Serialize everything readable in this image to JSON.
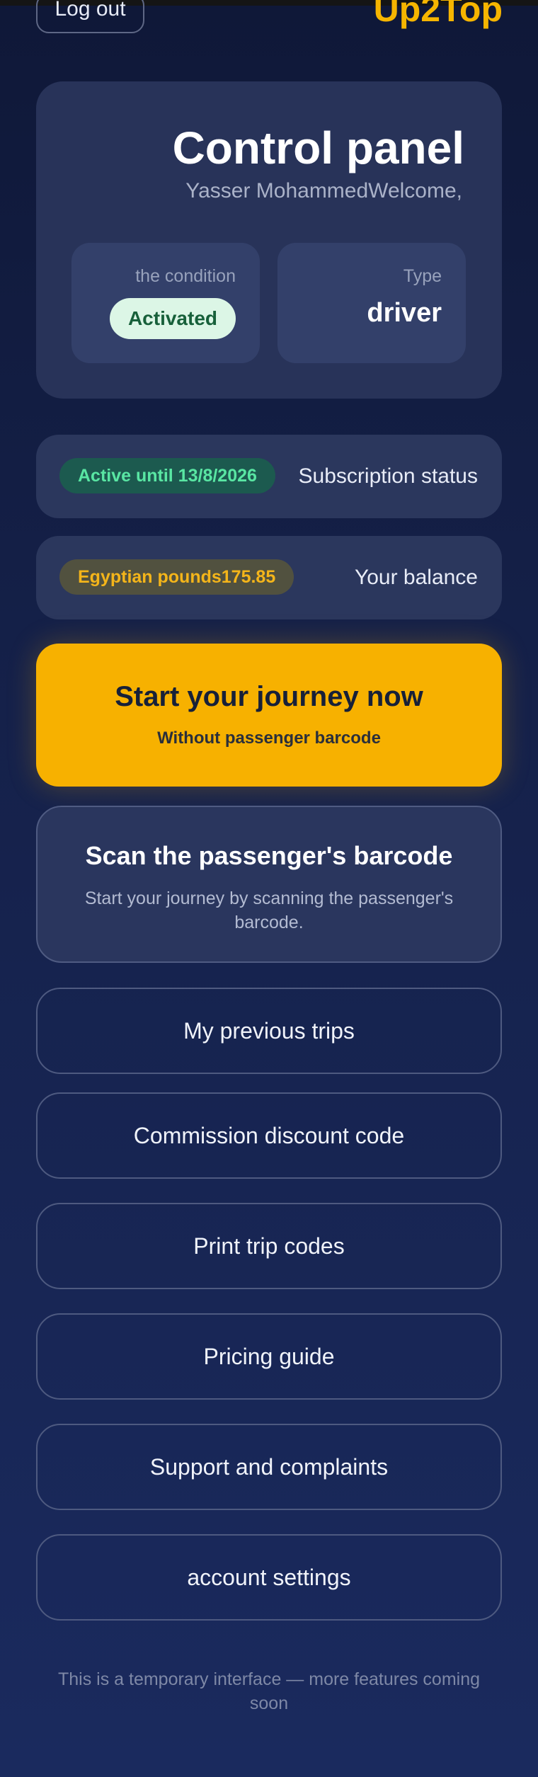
{
  "header": {
    "logout_label": "Log out",
    "brand": "Up2Top"
  },
  "panel": {
    "title": "Control panel",
    "welcome": "Yasser MohammedWelcome,",
    "condition_label": "the condition",
    "condition_value": "Activated",
    "type_label": "Type",
    "type_value": "driver"
  },
  "subscription": {
    "label": "Subscription status",
    "badge": "Active until 13/8/2026"
  },
  "balance": {
    "label": "Your balance",
    "badge": "Egyptian pounds175.85"
  },
  "start_journey": {
    "title": "Start your journey now",
    "subtitle": "Without passenger barcode"
  },
  "scan": {
    "title": "Scan the passenger's barcode",
    "subtitle": "Start your journey by scanning the passenger's barcode."
  },
  "menu": [
    {
      "label": "My previous trips"
    },
    {
      "label": "Commission discount code"
    },
    {
      "label": "Print trip codes"
    },
    {
      "label": "Pricing guide"
    },
    {
      "label": "Support and complaints"
    },
    {
      "label": "account settings"
    }
  ],
  "footer": {
    "note": "This is a temporary interface — more features coming soon"
  },
  "colors": {
    "accent": "#f7b100",
    "status_green": "#59e6a3",
    "background": "#15214a"
  }
}
